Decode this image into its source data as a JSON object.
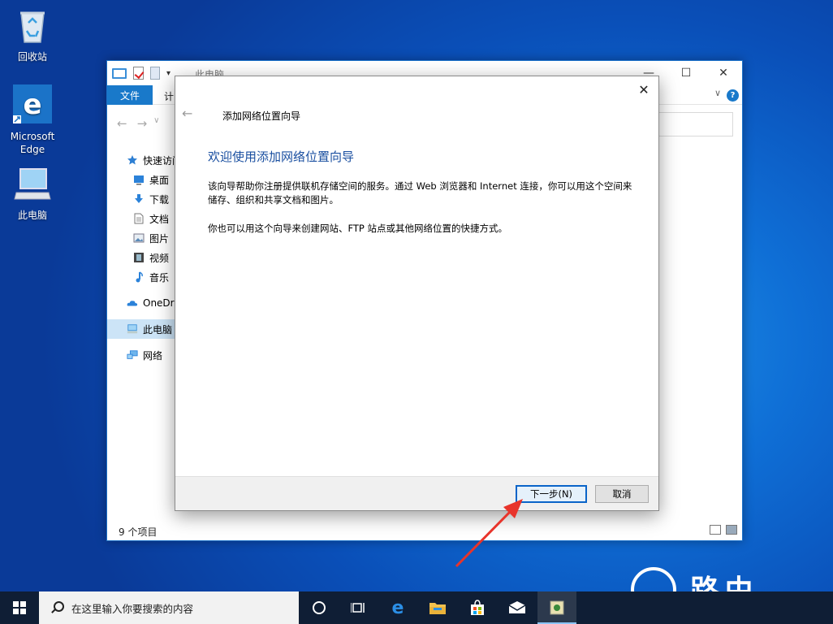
{
  "desktop": {
    "icons": [
      {
        "label": "回收站",
        "icon": "recycle-bin-icon"
      },
      {
        "label": "Microsoft\nEdge",
        "icon": "edge-icon"
      },
      {
        "label": "此电脑",
        "icon": "this-pc-icon"
      }
    ]
  },
  "explorer": {
    "title": "此电脑",
    "ribbon": {
      "file_tab": "文件",
      "computer_tab": "计"
    },
    "nav": [
      {
        "label": "快速访问",
        "icon": "star-icon"
      },
      {
        "label": "桌面",
        "icon": "desktop-icon"
      },
      {
        "label": "下载",
        "icon": "download-icon"
      },
      {
        "label": "文档",
        "icon": "document-icon"
      },
      {
        "label": "图片",
        "icon": "picture-icon"
      },
      {
        "label": "视频",
        "icon": "video-icon"
      },
      {
        "label": "音乐",
        "icon": "music-icon"
      },
      {
        "label": "OneDri",
        "icon": "onedrive-icon"
      },
      {
        "label": "此电脑",
        "icon": "this-pc-icon"
      },
      {
        "label": "网络",
        "icon": "network-icon"
      }
    ],
    "status": "9 个项目"
  },
  "wizard": {
    "title": "添加网络位置向导",
    "heading": "欢迎使用添加网络位置向导",
    "para1": "该向导帮助你注册提供联机存储空间的服务。通过 Web 浏览器和 Internet 连接，你可以用这个空间来储存、组织和共享文档和图片。",
    "para2": "你也可以用这个向导来创建网站、FTP 站点或其他网络位置的快捷方式。",
    "next_button": "下一步(N)",
    "cancel_button": "取消"
  },
  "taskbar": {
    "search_placeholder": "在这里输入你要搜索的内容"
  },
  "colors": {
    "accent": "#1979ca",
    "heading": "#1a4fa0",
    "arrow": "#e8342b",
    "taskbar": "#0f1e35"
  }
}
